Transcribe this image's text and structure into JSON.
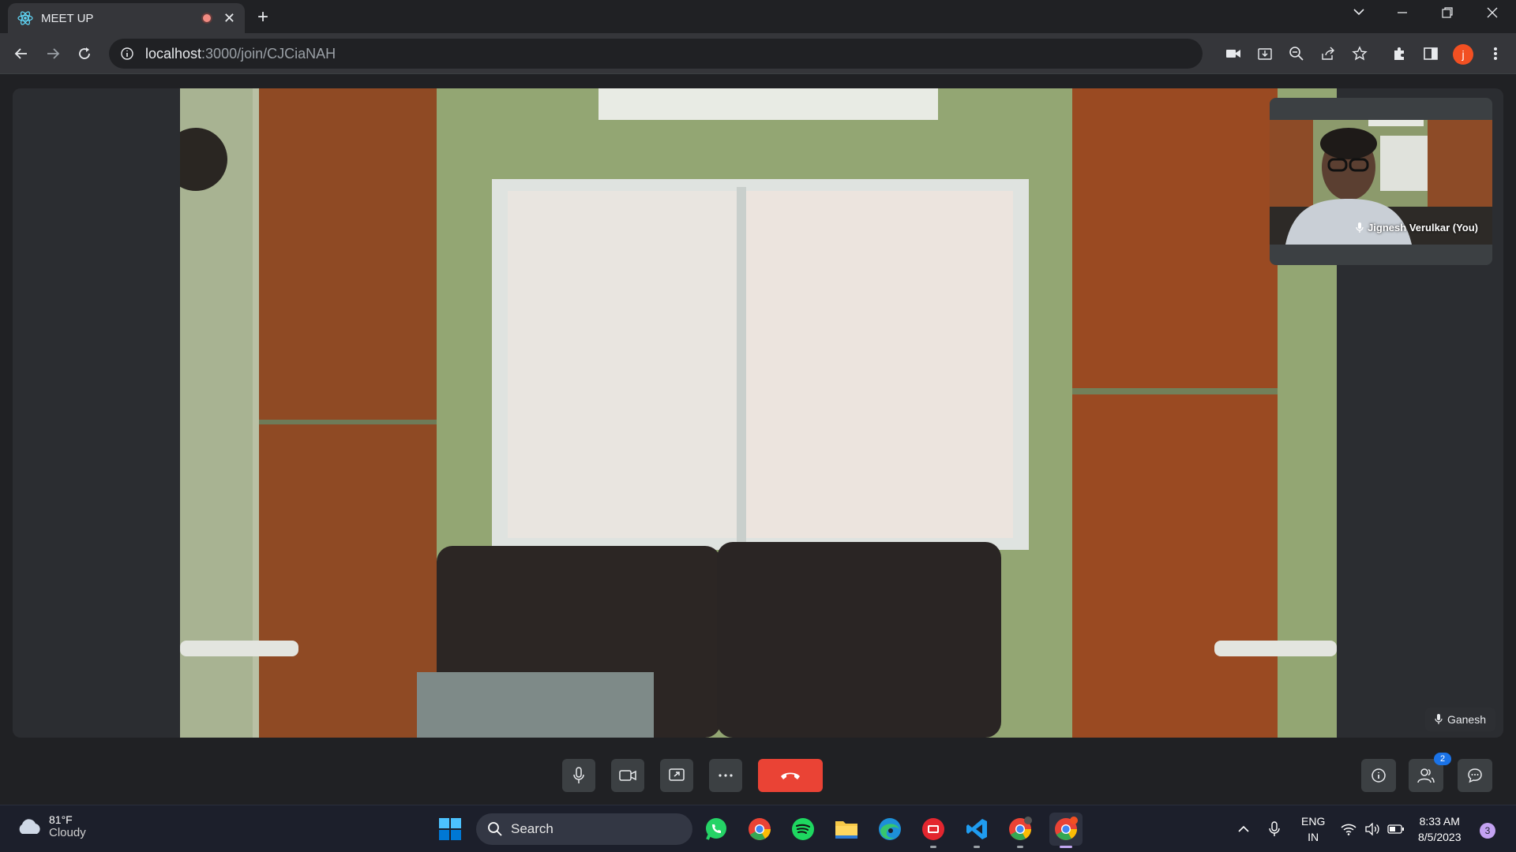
{
  "browser": {
    "tab_title": "MEET UP",
    "url_host": "localhost",
    "url_path": ":3000/join/CJCiaNAH",
    "profile_initial": "j"
  },
  "meeting": {
    "main_participant": "Ganesh",
    "self_participant": "Jignesh Verulkar (You)",
    "participants_count": "2"
  },
  "taskbar": {
    "weather_temp": "81°F",
    "weather_desc": "Cloudy",
    "search_label": "Search",
    "lang_top": "ENG",
    "lang_bottom": "IN",
    "time": "8:33 AM",
    "date": "8/5/2023",
    "notification_count": "3"
  },
  "colors": {
    "end_call": "#ea4335",
    "badge": "#1a73e8",
    "app_background": "#202124"
  }
}
